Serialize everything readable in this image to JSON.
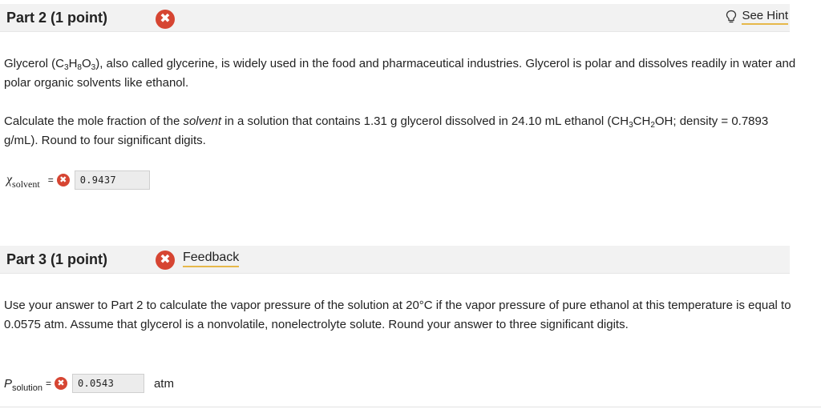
{
  "part2": {
    "title": "Part 2   (1 point)",
    "status_badge": "✖",
    "hint_label": "See Hint",
    "para1": {
      "a": "Glycerol (C",
      "s1": "3",
      "b": "H",
      "s2": "8",
      "c": "O",
      "s3": "3",
      "d": "), also called glycerine, is widely used in the food and pharmaceutical industries. Glycerol is polar and dissolves readily in water and polar organic solvents like ethanol."
    },
    "para2": {
      "a": "Calculate the mole fraction of the ",
      "em": "solvent",
      "b": " in a solution that contains 1.31 g glycerol dissolved in 24.10 mL ethanol (CH",
      "s1": "3",
      "c": "CH",
      "s2": "2",
      "d": "OH; density = 0.7893 g/mL). Round to four significant digits."
    },
    "answer": {
      "var_symbol": "χ",
      "var_sub": "solvent",
      "equals": "=",
      "badge": "✖",
      "value": "0.9437"
    }
  },
  "part3": {
    "title": "Part 3   (1 point)",
    "status_badge": "✖",
    "feedback_label": "Feedback",
    "para": "Use your answer to Part 2 to calculate the vapor pressure of the solution at 20°C if the vapor pressure of pure ethanol at this temperature is equal to 0.0575 atm. Assume that glycerol is a nonvolatile, nonelectrolyte solute. Round your answer to three significant digits.",
    "answer": {
      "var_symbol": "P",
      "var_sub": "solution",
      "equals": "=",
      "badge": "✖",
      "value": "0.0543",
      "unit": "atm"
    }
  },
  "colors": {
    "error_badge": "#d64532",
    "hint_underline": "#e6b84a",
    "header_bg": "#f2f2f2"
  },
  "icons": {
    "hint": "lightbulb-icon",
    "error": "x-circle-icon"
  }
}
